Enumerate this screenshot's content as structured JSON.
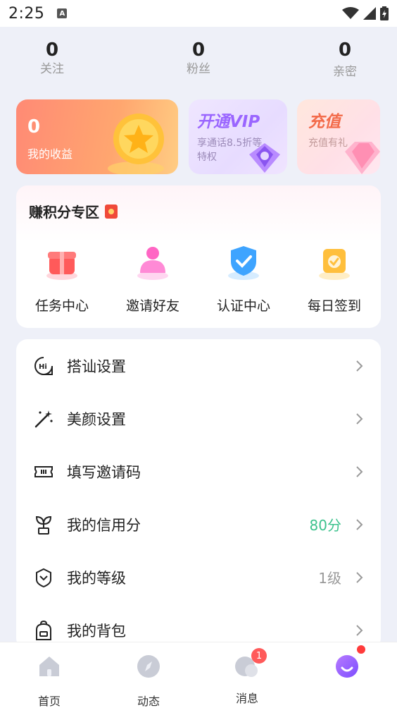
{
  "status_bar": {
    "time": "2:25",
    "notification_glyph": "A"
  },
  "stats": [
    {
      "value": "0",
      "label": "关注"
    },
    {
      "value": "0",
      "label": "粉丝"
    },
    {
      "value": "0",
      "label": "亲密"
    }
  ],
  "cards": {
    "income": {
      "value": "0",
      "label": "我的收益"
    },
    "vip": {
      "title": "开通VIP",
      "desc": "享通话8.5折等特权"
    },
    "recharge": {
      "title": "充值",
      "desc": "充值有礼"
    }
  },
  "points_zone": {
    "title": "赚积分专区",
    "items": [
      {
        "label": "任务中心",
        "icon": "gift-icon"
      },
      {
        "label": "邀请好友",
        "icon": "invite-user-icon"
      },
      {
        "label": "认证中心",
        "icon": "shield-check-icon"
      },
      {
        "label": "每日签到",
        "icon": "calendar-check-icon"
      }
    ]
  },
  "menu": [
    {
      "label": "搭讪设置",
      "value": "",
      "icon": "hi-chat-icon"
    },
    {
      "label": "美颜设置",
      "value": "",
      "icon": "magic-wand-icon"
    },
    {
      "label": "填写邀请码",
      "value": "",
      "icon": "ticket-icon"
    },
    {
      "label": "我的信用分",
      "value": "80分",
      "value_color": "#3cc28d",
      "icon": "sprout-icon"
    },
    {
      "label": "我的等级",
      "value": "1级",
      "value_color": "#999999",
      "icon": "badge-level-icon"
    },
    {
      "label": "我的背包",
      "value": "",
      "icon": "backpack-icon"
    }
  ],
  "bottom_nav": [
    {
      "label": "首页",
      "icon": "home-icon"
    },
    {
      "label": "动态",
      "icon": "compass-icon"
    },
    {
      "label": "消息",
      "icon": "chat-bubble-icon",
      "badge": "1"
    },
    {
      "label": "",
      "icon": "profile-smile-icon"
    }
  ],
  "colors": {
    "accent_purple": "#9a66ff",
    "credit_green": "#3cc28d",
    "badge_red": "#ff5a5a"
  }
}
